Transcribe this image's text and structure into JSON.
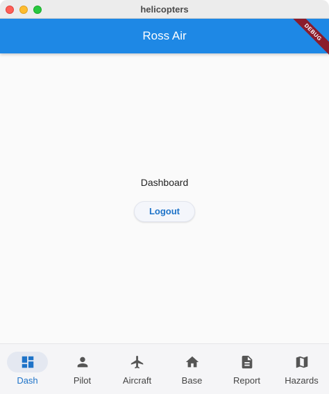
{
  "window": {
    "title": "helicopters"
  },
  "appbar": {
    "title": "Ross Air",
    "debug_label": "DEBUG"
  },
  "content": {
    "label": "Dashboard",
    "logout_label": "Logout"
  },
  "nav": {
    "items": [
      {
        "label": "Dash",
        "icon": "dashboard-icon",
        "active": true
      },
      {
        "label": "Pilot",
        "icon": "person-icon",
        "active": false
      },
      {
        "label": "Aircraft",
        "icon": "airplane-icon",
        "active": false
      },
      {
        "label": "Base",
        "icon": "home-icon",
        "active": false
      },
      {
        "label": "Report",
        "icon": "document-icon",
        "active": false
      },
      {
        "label": "Hazards",
        "icon": "map-icon",
        "active": false
      }
    ]
  },
  "colors": {
    "appbar": "#1e88e5",
    "accent": "#1e73c8",
    "debug": "#8b1c2c",
    "icon": "#555555"
  }
}
